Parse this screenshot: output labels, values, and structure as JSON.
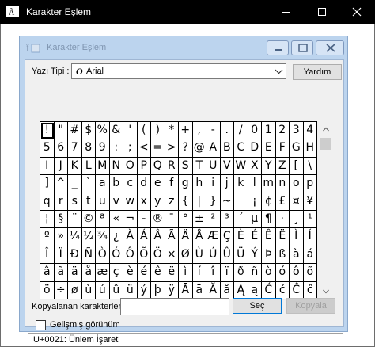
{
  "window": {
    "title": "Karakter Eşlem"
  },
  "dialog": {
    "title": "Karakter Eşlem"
  },
  "font_row": {
    "label": "Yazı Tipi :",
    "selected_font": "Arial",
    "help_button": "Yardım"
  },
  "grid": {
    "rows": [
      [
        "!",
        "\"",
        "#",
        "$",
        "%",
        "&",
        "'",
        "(",
        ")",
        "*",
        "+",
        ",",
        "-",
        ".",
        "/",
        "0",
        "1",
        "2",
        "3",
        "4"
      ],
      [
        "5",
        "6",
        "7",
        "8",
        "9",
        ":",
        ";",
        "<",
        "=",
        ">",
        "?",
        "@",
        "A",
        "B",
        "C",
        "D",
        "E",
        "F",
        "G",
        "H"
      ],
      [
        "I",
        "J",
        "K",
        "L",
        "M",
        "N",
        "O",
        "P",
        "Q",
        "R",
        "S",
        "T",
        "U",
        "V",
        "W",
        "X",
        "Y",
        "Z",
        "[",
        "\\"
      ],
      [
        "]",
        "^",
        "_",
        "`",
        "a",
        "b",
        "c",
        "d",
        "e",
        "f",
        "g",
        "h",
        "i",
        "j",
        "k",
        "l",
        "m",
        "n",
        "o",
        "p"
      ],
      [
        "q",
        "r",
        "s",
        "t",
        "u",
        "v",
        "w",
        "x",
        "y",
        "z",
        "{",
        "|",
        "}",
        "~",
        " ",
        "¡",
        "¢",
        "£",
        "¤",
        "¥"
      ],
      [
        "¦",
        "§",
        "¨",
        "©",
        "ª",
        "«",
        "¬",
        "-",
        "®",
        "¯",
        "°",
        "±",
        "²",
        "³",
        "´",
        "µ",
        "¶",
        "·",
        "¸",
        "¹"
      ],
      [
        "º",
        "»",
        "¼",
        "½",
        "¾",
        "¿",
        "À",
        "Á",
        "Â",
        "Ã",
        "Ä",
        "Å",
        "Æ",
        "Ç",
        "È",
        "É",
        "Ê",
        "Ë",
        "Ì",
        "Í"
      ],
      [
        "Î",
        "Ï",
        "Ð",
        "Ñ",
        "Ò",
        "Ó",
        "Ô",
        "Õ",
        "Ö",
        "×",
        "Ø",
        "Ù",
        "Ú",
        "Û",
        "Ü",
        "Ý",
        "Þ",
        "ß",
        "à",
        "á"
      ],
      [
        "â",
        "ã",
        "ä",
        "å",
        "æ",
        "ç",
        "è",
        "é",
        "ê",
        "ë",
        "ì",
        "í",
        "î",
        "ï",
        "ð",
        "ñ",
        "ò",
        "ó",
        "ô",
        "õ"
      ],
      [
        "ö",
        "÷",
        "ø",
        "ù",
        "ú",
        "û",
        "ü",
        "ý",
        "þ",
        "ÿ",
        "Ā",
        "ā",
        "Ă",
        "ă",
        "Ą",
        "ą",
        "Ć",
        "ć",
        "Ĉ",
        "ĉ"
      ]
    ],
    "selected": "!"
  },
  "copy_row": {
    "label": "Kopyalanan karakterler :",
    "value": "",
    "select_button": "Seç",
    "copy_button": "Kopyala"
  },
  "advanced": {
    "label": "Gelişmiş görünüm",
    "checked": false
  },
  "status": {
    "text": "U+0021: Ünlem İşareti"
  }
}
